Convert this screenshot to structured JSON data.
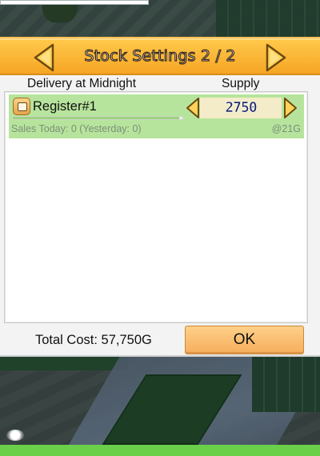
{
  "dialog": {
    "title": "Stock Settings 2 / 2"
  },
  "columns": {
    "delivery": "Delivery at Midnight",
    "supply": "Supply"
  },
  "items": [
    {
      "name": "Register#1",
      "icon": "cash-register-icon",
      "supply": "2750",
      "sales_text": "Sales Today: 0 (Yesterday: 0)",
      "unit_price": "@21G",
      "stock_level": 0.98
    }
  ],
  "footer": {
    "total_cost": "Total Cost: 57,750G",
    "ok_label": "OK"
  },
  "colors": {
    "title_bar": "#f6a524",
    "row_highlight": "#b7e49c",
    "ok_button": "#f6ad5c",
    "supply_text": "#1f2a66"
  }
}
